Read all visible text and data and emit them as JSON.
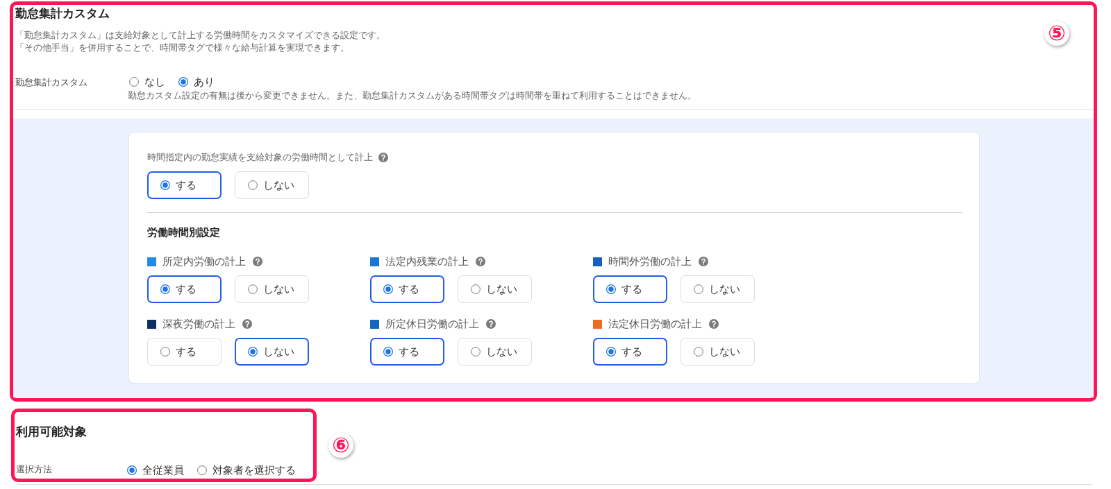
{
  "attendance_custom": {
    "title": "勤怠集計カスタム",
    "callout": "⑤",
    "description": [
      "「勤怠集計カスタム」は支給対象として計上する労働時間をカスタマイズできる設定です。",
      "「その他手当」を併用することで、時間帯タグで様々な給与計算を実現できます。"
    ],
    "setting": {
      "label": "勤怠集計カスタム",
      "options": [
        {
          "label": "なし",
          "selected": false
        },
        {
          "label": "あり",
          "selected": true
        }
      ],
      "note": "勤怠カスタム設定の有無は後から変更できません。また、勤怠集計カスタムがある時間帯タグは時間帯を重ねて利用することはできません。"
    },
    "panel": {
      "question": {
        "label": "時間指定内の勤怠実績を支給対象の労働時間として計上",
        "options": [
          {
            "label": "する",
            "selected": true
          },
          {
            "label": "しない",
            "selected": false
          }
        ]
      },
      "subheading": "労働時間別設定",
      "items": [
        {
          "label": "所定内労働の計上",
          "color": "#2389e6",
          "options": [
            {
              "label": "する",
              "selected": true
            },
            {
              "label": "しない",
              "selected": false
            }
          ]
        },
        {
          "label": "法定内残業の計上",
          "color": "#1976d2",
          "options": [
            {
              "label": "する",
              "selected": true
            },
            {
              "label": "しない",
              "selected": false
            }
          ]
        },
        {
          "label": "時間外労働の計上",
          "color": "#1560bd",
          "options": [
            {
              "label": "する",
              "selected": true
            },
            {
              "label": "しない",
              "selected": false
            }
          ]
        },
        {
          "label": "深夜労働の計上",
          "color": "#0e3160",
          "options": [
            {
              "label": "する",
              "selected": false
            },
            {
              "label": "しない",
              "selected": true
            }
          ]
        },
        {
          "label": "所定休日労働の計上",
          "color": "#1565c0",
          "options": [
            {
              "label": "する",
              "selected": true
            },
            {
              "label": "しない",
              "selected": false
            }
          ]
        },
        {
          "label": "法定休日労働の計上",
          "color": "#ee6b22",
          "options": [
            {
              "label": "する",
              "selected": true
            },
            {
              "label": "しない",
              "selected": false
            }
          ]
        }
      ]
    }
  },
  "available_targets": {
    "title": "利用可能対象",
    "callout": "⑥",
    "setting": {
      "label": "選択方法",
      "options": [
        {
          "label": "全従業員",
          "selected": true
        },
        {
          "label": "対象者を選択する",
          "selected": false
        }
      ]
    }
  }
}
